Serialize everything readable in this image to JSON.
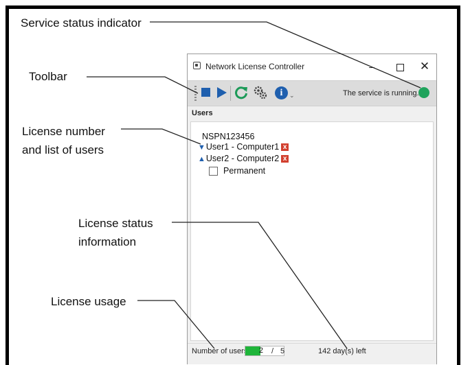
{
  "callouts": {
    "service_status": "Service status indicator",
    "toolbar": "Toolbar",
    "license_users": "License number\nand list of users",
    "license_status": "License status\ninformation",
    "license_usage": "License usage"
  },
  "window": {
    "title": "Network License Controller",
    "controls": {
      "minimize": "–",
      "close": "✕"
    }
  },
  "toolbar": {
    "icons": [
      "stop-icon",
      "play-icon",
      "refresh-icon",
      "settings-icon",
      "info-icon",
      "overflow-icon"
    ],
    "info_glyph": "i",
    "overflow_glyph": "⌄",
    "service_text": "The service is running.",
    "service_status_color": "#1fa35c"
  },
  "users": {
    "heading": "Users",
    "license_number": "NSPN123456",
    "list": [
      {
        "expand": "▼",
        "label": "User1 - Computer1",
        "remove": "x"
      },
      {
        "expand": "▲",
        "label": "User2 - Computer2",
        "remove": "x"
      }
    ],
    "permanent_label": "Permanent"
  },
  "statusbar": {
    "users_label": "Number of users",
    "used": "2",
    "separator": "/",
    "max": "5",
    "usage_fraction": 0.4,
    "usage_color": "#1fb53a",
    "days_left": "142 day(s) left"
  }
}
